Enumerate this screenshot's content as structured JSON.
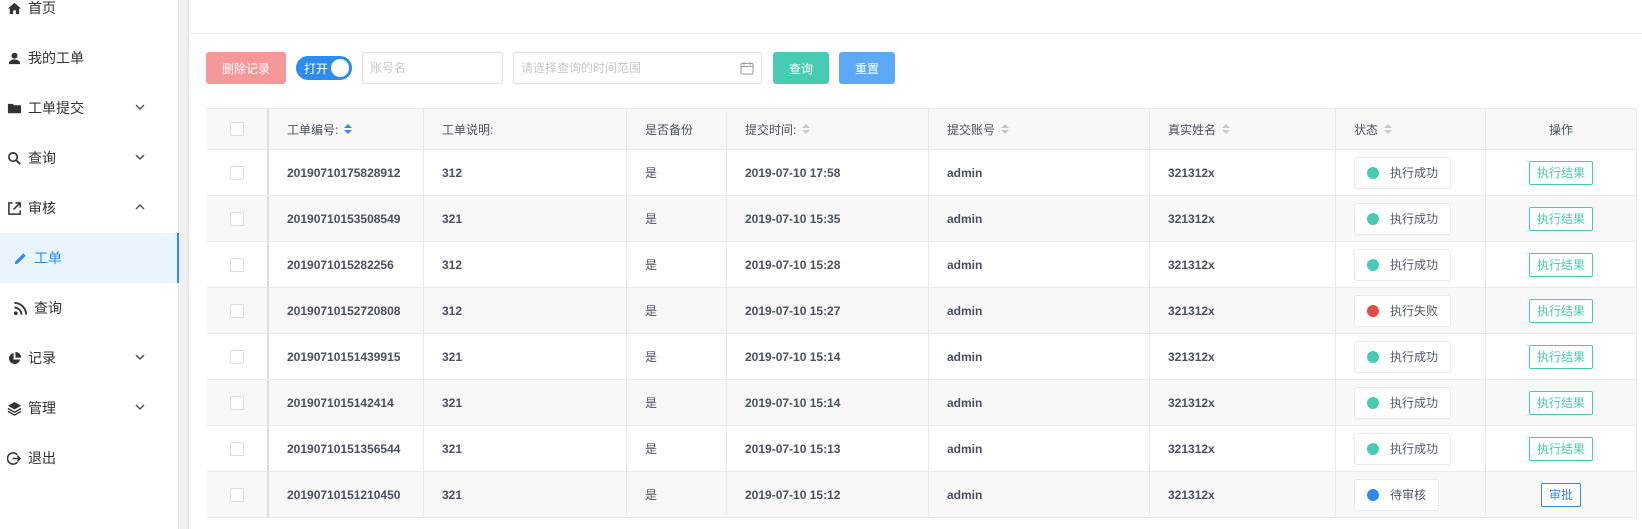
{
  "sidebar": {
    "items": [
      {
        "label": "首页",
        "icon": "home-icon"
      },
      {
        "label": "我的工单",
        "icon": "user-icon"
      },
      {
        "label": "工单提交",
        "icon": "folder-icon"
      },
      {
        "label": "查询",
        "icon": "search-icon"
      },
      {
        "label": "审核",
        "icon": "external-link-icon"
      },
      {
        "label": "工单",
        "icon": "pencil-icon"
      },
      {
        "label": "查询",
        "icon": "rss-icon"
      },
      {
        "label": "记录",
        "icon": "pie-chart-icon"
      },
      {
        "label": "管理",
        "icon": "layers-icon"
      },
      {
        "label": "退出",
        "icon": "logout-icon"
      }
    ]
  },
  "toolbar": {
    "delete_label": "删除记录",
    "toggle_label": "打开",
    "account_placeholder": "账号名",
    "date_placeholder": "请选择查询的时间范围",
    "query_label": "查询",
    "reset_label": "重置"
  },
  "table": {
    "headers": [
      "工单编号:",
      "工单说明:",
      "是否备份",
      "提交时间:",
      "提交账号",
      "真实姓名",
      "状态",
      "操作"
    ],
    "rows": [
      {
        "id": "20190710175828912",
        "desc": "312",
        "backup": "是",
        "time": "2019-07-10 17:58",
        "account": "admin",
        "name": "321312x",
        "status": "执行成功",
        "status_color": "#47cbb3",
        "action": "执行结果"
      },
      {
        "id": "20190710153508549",
        "desc": "321",
        "backup": "是",
        "time": "2019-07-10 15:35",
        "account": "admin",
        "name": "321312x",
        "status": "执行成功",
        "status_color": "#47cbb3",
        "action": "执行结果"
      },
      {
        "id": "2019071015282256",
        "desc": "312",
        "backup": "是",
        "time": "2019-07-10 15:28",
        "account": "admin",
        "name": "321312x",
        "status": "执行成功",
        "status_color": "#47cbb3",
        "action": "执行结果"
      },
      {
        "id": "20190710152720808",
        "desc": "312",
        "backup": "是",
        "time": "2019-07-10 15:27",
        "account": "admin",
        "name": "321312x",
        "status": "执行失败",
        "status_color": "#e54d42",
        "action": "执行结果"
      },
      {
        "id": "20190710151439915",
        "desc": "321",
        "backup": "是",
        "time": "2019-07-10 15:14",
        "account": "admin",
        "name": "321312x",
        "status": "执行成功",
        "status_color": "#47cbb3",
        "action": "执行结果"
      },
      {
        "id": "2019071015142414",
        "desc": "321",
        "backup": "是",
        "time": "2019-07-10 15:14",
        "account": "admin",
        "name": "321312x",
        "status": "执行成功",
        "status_color": "#47cbb3",
        "action": "执行结果"
      },
      {
        "id": "20190710151356544",
        "desc": "321",
        "backup": "是",
        "time": "2019-07-10 15:13",
        "account": "admin",
        "name": "321312x",
        "status": "执行成功",
        "status_color": "#47cbb3",
        "action": "执行结果"
      },
      {
        "id": "20190710151210450",
        "desc": "321",
        "backup": "是",
        "time": "2019-07-10 15:12",
        "account": "admin",
        "name": "321312x",
        "status": "待审核",
        "status_color": "#2d8cf0",
        "action": "审批"
      }
    ]
  }
}
